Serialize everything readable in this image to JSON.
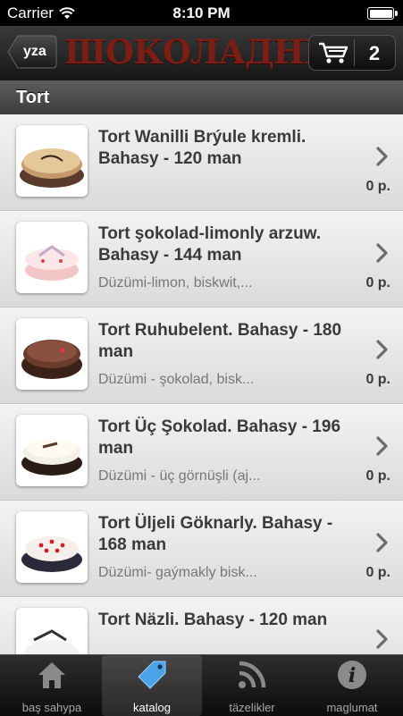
{
  "status_bar": {
    "carrier": "Carrier",
    "time": "8:10 PM"
  },
  "nav": {
    "back_label": "yza",
    "brand": "ШОКОЛАДНИЦА",
    "cart_count": "2"
  },
  "section": {
    "title": "Tort"
  },
  "products": [
    {
      "title": "Tort Wanilli Brýule kremli. Bahasy - 120 man",
      "desc": "",
      "price": "0 р."
    },
    {
      "title": "Tort şokolad-limonly arzuw. Bahasy - 144 man",
      "desc": "Düzümi-limon, biskwit,...",
      "price": "0 р."
    },
    {
      "title": "Tort Ruhubelent. Bahasy - 180 man",
      "desc": "Düzümi - şokolad, bisk...",
      "price": "0 р."
    },
    {
      "title": "Tort Üç Şokolad. Bahasy - 196 man",
      "desc": "Düzümi - üç görnüşli (aj...",
      "price": "0 р."
    },
    {
      "title": "Tort Üljeli Göknarly. Bahasy - 168 man",
      "desc": "Düzümi- gaýmakly bisk...",
      "price": "0 р."
    },
    {
      "title": "Tort Näzli. Bahasy - 120 man",
      "desc": "",
      "price": ""
    }
  ],
  "tabs": [
    {
      "label": "baş sahypa",
      "icon": "home-icon"
    },
    {
      "label": "katalog",
      "icon": "tag-icon"
    },
    {
      "label": "täzelikler",
      "icon": "rss-icon"
    },
    {
      "label": "maglumat",
      "icon": "info-icon"
    }
  ],
  "colors": {
    "brand": "#7a1e16",
    "active_tab_icon": "#4aa3e8"
  }
}
